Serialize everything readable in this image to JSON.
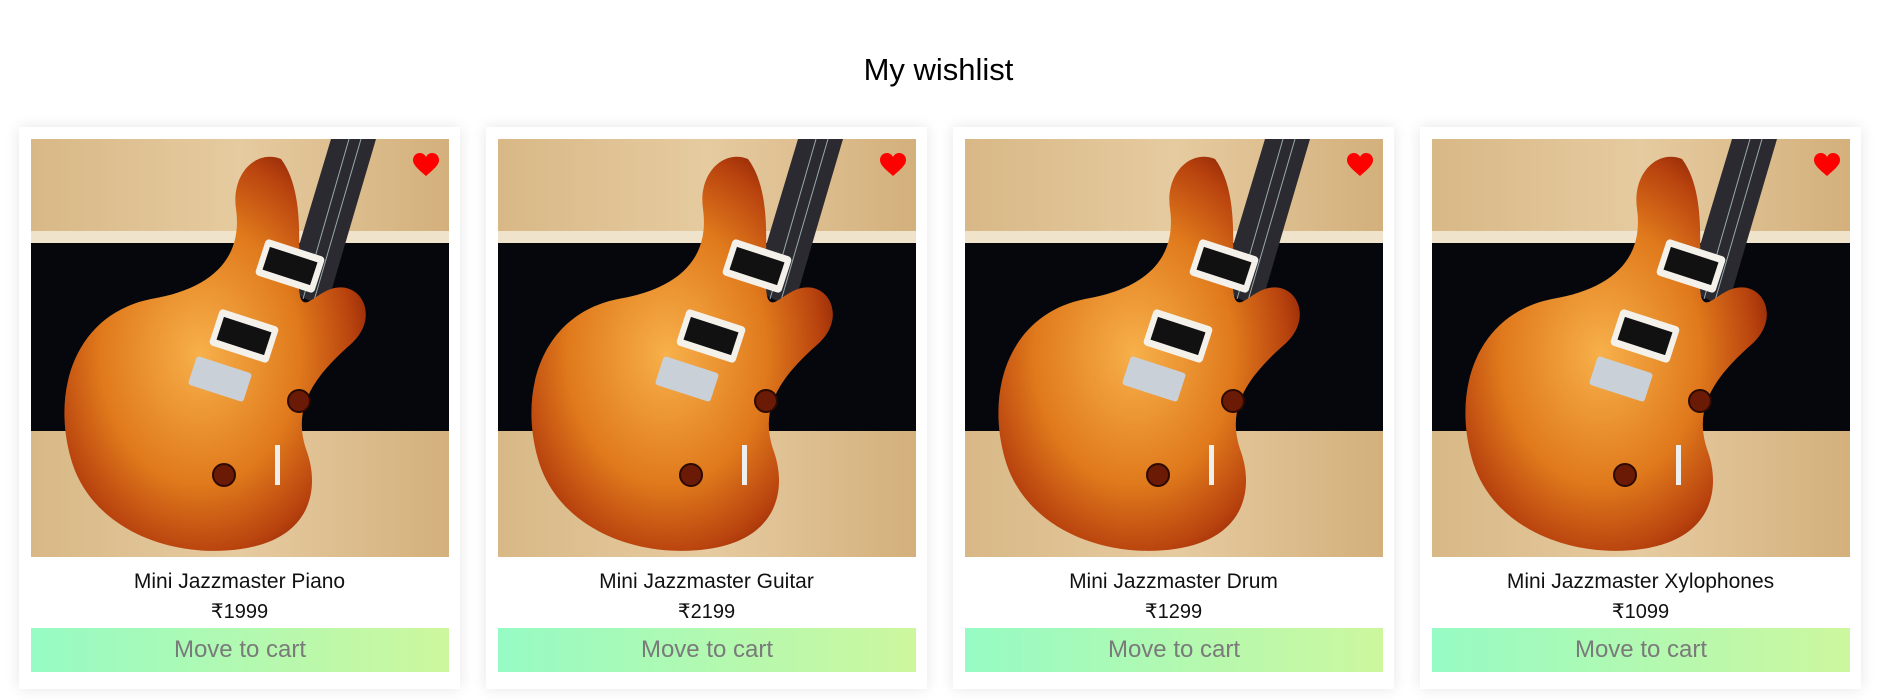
{
  "page": {
    "title": "My wishlist"
  },
  "wishlist": {
    "items": [
      {
        "name": "Mini Jazzmaster Piano",
        "price": "₹1999",
        "button_label": "Move to cart",
        "icon": "heart-icon"
      },
      {
        "name": "Mini Jazzmaster Guitar",
        "price": "₹2199",
        "button_label": "Move to cart",
        "icon": "heart-icon"
      },
      {
        "name": "Mini Jazzmaster Drum",
        "price": "₹1299",
        "button_label": "Move to cart",
        "icon": "heart-icon"
      },
      {
        "name": "Mini Jazzmaster Xylophones",
        "price": "₹1099",
        "button_label": "Move to cart",
        "icon": "heart-icon"
      }
    ]
  },
  "colors": {
    "heart": "#ff0000",
    "button_gradient_start": "#96fbc4",
    "button_gradient_end": "#cdf79e",
    "button_text": "#7a7a7a"
  }
}
